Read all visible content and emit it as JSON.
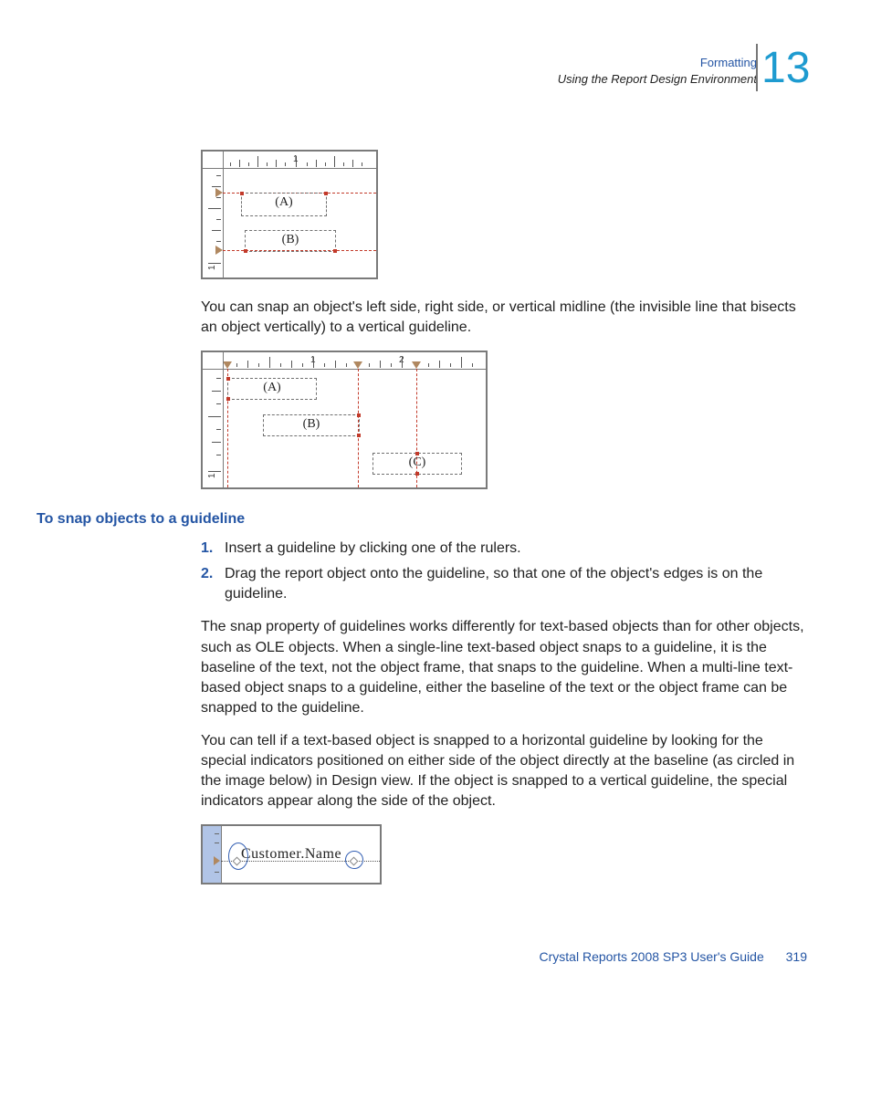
{
  "header": {
    "line1": "Formatting",
    "line2": "Using the Report Design Environment",
    "chapter_number": "13"
  },
  "para1": "You can snap an object's left side, right side, or vertical midline (the invisible line that bisects an object vertically) to a vertical guideline.",
  "section_heading": "To snap objects to a guideline",
  "steps": [
    {
      "n": "1.",
      "t": "Insert a guideline by clicking one of the rulers."
    },
    {
      "n": "2.",
      "t": "Drag the report object onto the guideline, so that one of the object's edges is on the guideline."
    }
  ],
  "para2": "The snap property of guidelines works differently for text-based objects than for other objects, such as OLE objects. When a single-line text-based object snaps to a guideline, it is the baseline of the text, not the object frame, that snaps to the guideline. When a multi-line text-based object snaps to a guideline, either the baseline of the text or the object frame can be snapped to the guideline.",
  "para3": "You can tell if a text-based object is snapped to a horizontal guideline by looking for the special indicators positioned on either side of the object directly at the baseline (as circled in the image below) in Design view. If the object is snapped to a vertical guideline, the special indicators appear along the side of the object.",
  "fig1": {
    "ruler_label_1": "1",
    "vlabel_1": "1",
    "box_a": "(A)",
    "box_b": "(B)"
  },
  "fig2": {
    "ruler_label_1": "1",
    "ruler_label_2": "2",
    "vlabel_1": "1",
    "box_a": "(A)",
    "box_b": "(B)",
    "box_c": "(C)"
  },
  "fig3": {
    "field": "Customer.Name"
  },
  "footer": {
    "doc": "Crystal Reports 2008 SP3 User's Guide",
    "page": "319"
  }
}
